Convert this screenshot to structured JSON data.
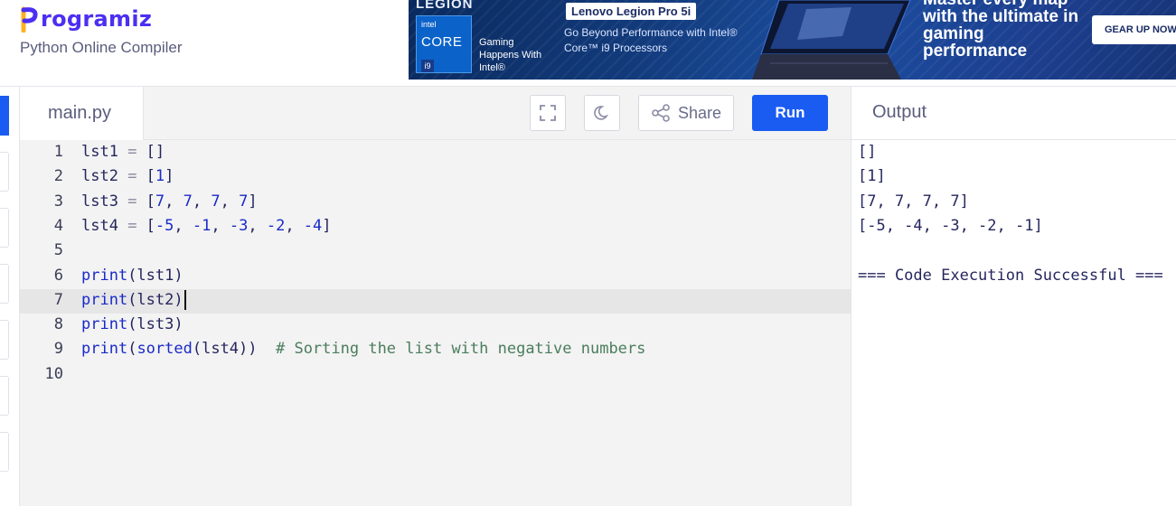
{
  "header": {
    "logo_text": "rogramiz",
    "subtitle": "Python Online Compiler"
  },
  "ad": {
    "legion": "LEGION",
    "intel": "intel",
    "core": "CORE",
    "i9": "i9",
    "happens": "Gaming Happens With Intel®",
    "badge": "Lenovo Legion Pro 5i",
    "desc": "Go Beyond Performance with Intel® Core™ i9 Processors",
    "headline": "Master every map with the ultimate in gaming performance",
    "cta": "GEAR UP NOW"
  },
  "toolbar": {
    "file_name": "main.py",
    "share_label": "Share",
    "run_label": "Run"
  },
  "editor": {
    "line_numbers": [
      "1",
      "2",
      "3",
      "4",
      "5",
      "6",
      "7",
      "8",
      "9",
      "10"
    ],
    "lines": [
      "lst1 = []",
      "lst2 = [1]",
      "lst3 = [7, 7, 7, 7]",
      "lst4 = [-5, -1, -3, -2, -4]",
      "",
      "print(lst1)",
      "print(lst2)",
      "print(lst3)",
      "print(sorted(lst4))  # Sorting the list with negative numbers",
      ""
    ],
    "active_line": 7
  },
  "output": {
    "title": "Output",
    "lines": [
      "[]",
      "[1]",
      "[7, 7, 7, 7]",
      "[-5, -4, -3, -2, -1]",
      "",
      "=== Code Execution Successful ==="
    ]
  },
  "colors": {
    "brand": "#4b2ff2",
    "run_button": "#1a5cf2"
  },
  "icons": [
    "fullscreen-icon",
    "moon-icon",
    "share-icon"
  ]
}
